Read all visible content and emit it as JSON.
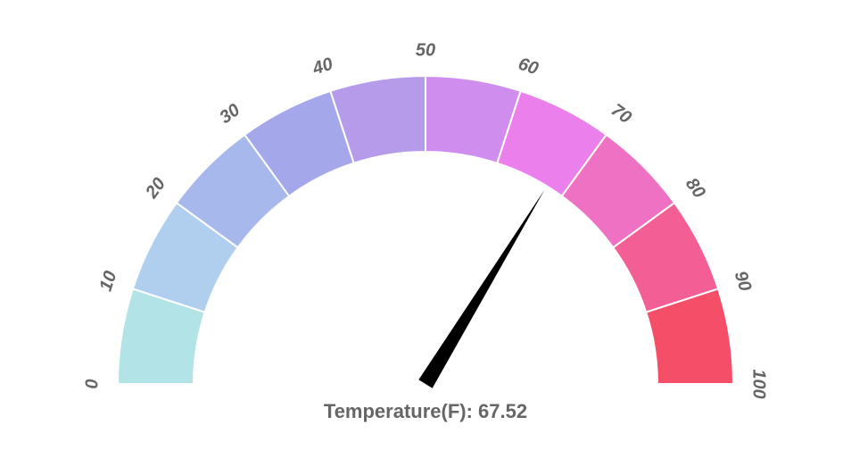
{
  "chart_data": {
    "type": "gauge",
    "min": 0,
    "max": 100,
    "value": 67.52,
    "ticks": [
      0,
      10,
      20,
      30,
      40,
      50,
      60,
      70,
      80,
      90,
      100
    ],
    "segments": [
      {
        "from": 0,
        "to": 10,
        "color": "#b2e3e6"
      },
      {
        "from": 10,
        "to": 20,
        "color": "#b0cfee"
      },
      {
        "from": 20,
        "to": 30,
        "color": "#a7b9ec"
      },
      {
        "from": 30,
        "to": 40,
        "color": "#a5a7eb"
      },
      {
        "from": 40,
        "to": 50,
        "color": "#b69beb"
      },
      {
        "from": 50,
        "to": 60,
        "color": "#cf8eee"
      },
      {
        "from": 60,
        "to": 70,
        "color": "#eb80ed"
      },
      {
        "from": 70,
        "to": 80,
        "color": "#ef71c3"
      },
      {
        "from": 80,
        "to": 90,
        "color": "#f35f95"
      },
      {
        "from": 90,
        "to": 100,
        "color": "#f44e68"
      }
    ],
    "label_prefix": "Temperature(F): ",
    "tick_labels": {
      "0": "0",
      "10": "10",
      "20": "20",
      "30": "30",
      "40": "40",
      "50": "50",
      "60": "60",
      "70": "70",
      "80": "80",
      "90": "90",
      "100": "100"
    }
  }
}
